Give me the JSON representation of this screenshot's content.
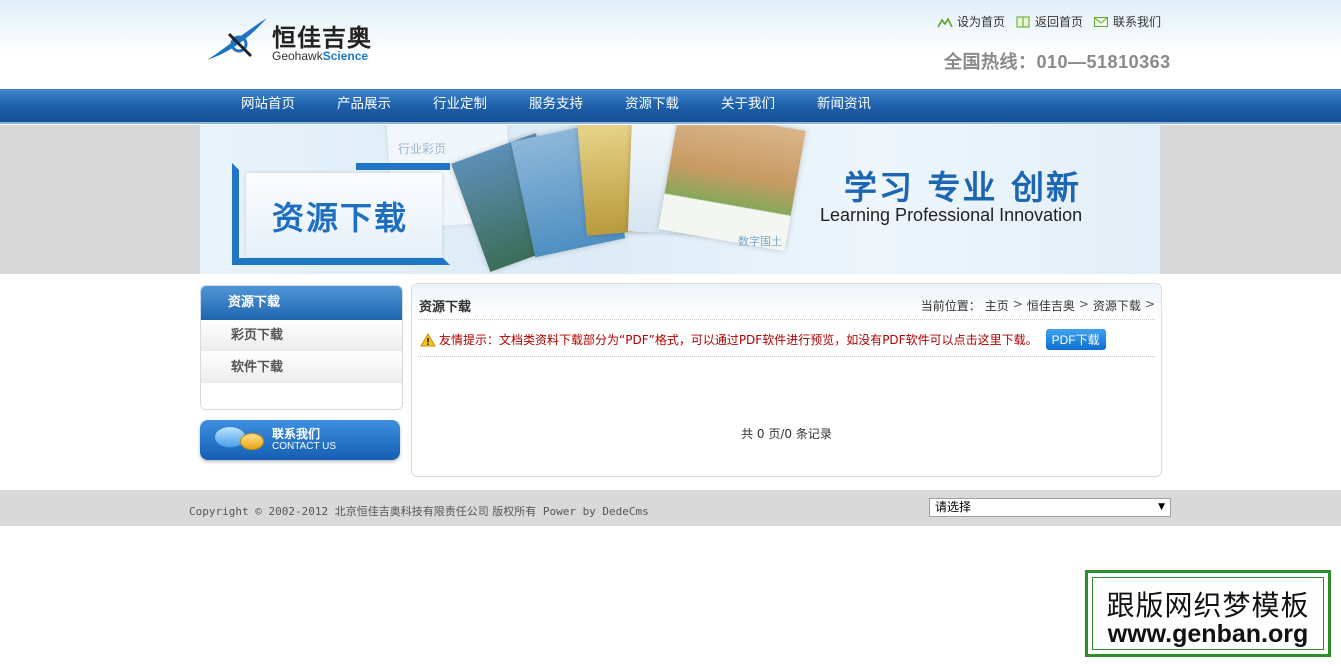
{
  "logo": {
    "cn": "恒佳吉奥",
    "en_a": "Geohawk",
    "en_b": "Science"
  },
  "toplinks": [
    {
      "label": "设为首页",
      "icon": "home-icon"
    },
    {
      "label": "返回首页",
      "icon": "book-icon"
    },
    {
      "label": "联系我们",
      "icon": "mail-icon"
    }
  ],
  "hotline": "全国热线：010—51810363",
  "nav": [
    "网站首页",
    "产品展示",
    "行业定制",
    "服务支持",
    "资源下载",
    "关于我们",
    "新闻资讯"
  ],
  "banner": {
    "title": "资源下载",
    "slogan_cn": "学习 专业 创新",
    "slogan_en": "Learning  Professional  Innovation",
    "tag": "行业彩页",
    "tag2": "数字国土"
  },
  "sidebar": {
    "heading": "资源下载",
    "items": [
      "彩页下载",
      "软件下载"
    ],
    "contact_cn": "联系我们",
    "contact_en": "CONTACT US"
  },
  "main": {
    "title": "资源下载",
    "crumbs_prefix": "当前位置：",
    "crumbs": [
      "主页",
      "恒佳吉奥",
      "资源下载"
    ],
    "tip": "友情提示：文档类资料下载部分为“PDF”格式，可以通过PDF软件进行预览，如没有PDF软件可以点击这里下载。",
    "pdf_button": "PDF下载",
    "pager": "共 0 页/0 条记录"
  },
  "footer": {
    "copy_a": "Copyright © 2002-2012",
    "copy_cn": "北京恒佳吉奥科技有限责任公司 版权所有",
    "copy_b": "Power by DedeCms",
    "select": "请选择"
  },
  "watermark": {
    "cn": "跟版网织梦模板",
    "url": "www.genban.org"
  },
  "colors": {
    "nav": "#1f63ad",
    "accent": "#1e6fc0",
    "tip": "#b20000",
    "footer": "#d9d9d9"
  }
}
